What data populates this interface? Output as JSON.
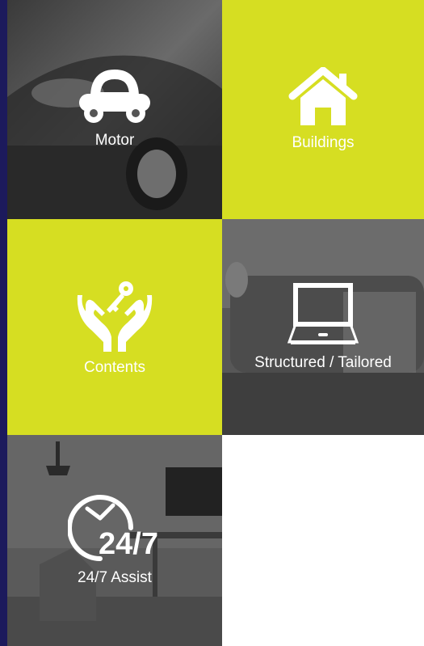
{
  "colors": {
    "accent": "#d6de22",
    "dark_tile": "#4a4a4a",
    "left_strip": "#1c1a5c",
    "label_text": "#ffffff"
  },
  "tiles": [
    {
      "id": "motor",
      "label": "Motor",
      "icon": "car-icon",
      "style": "photo"
    },
    {
      "id": "buildings",
      "label": "Buildings",
      "icon": "house-icon",
      "style": "accent"
    },
    {
      "id": "contents",
      "label": "Contents",
      "icon": "hands-key-icon",
      "style": "accent"
    },
    {
      "id": "structured",
      "label": "Structured / Tailored",
      "icon": "laptop-icon",
      "style": "photo"
    },
    {
      "id": "assist",
      "label": "24/7 Assist",
      "icon": "clock-24-7-icon",
      "style": "photo"
    }
  ],
  "assist_icon_text": "24/7"
}
